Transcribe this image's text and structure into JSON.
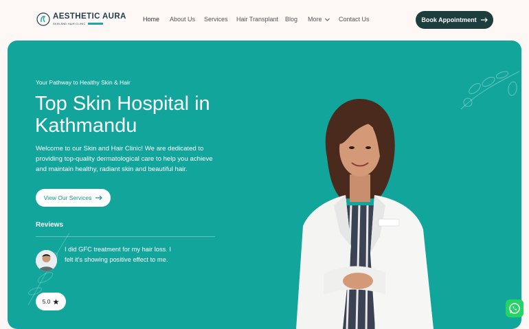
{
  "logo": {
    "name": "AESTHETIC AURA",
    "subtitle": "SKIN AND HAIR CLINIC"
  },
  "nav": {
    "items": [
      "Home",
      "About Us",
      "Services",
      "Hair Transplant",
      "Blog",
      "More",
      "Contact Us"
    ]
  },
  "header": {
    "cta_label": "Book Appointment"
  },
  "hero": {
    "tagline": "Your Pathway to Healthy Skin & Hair",
    "title": "Top Skin Hospital in Kathmandu",
    "description": "Welcome to our Skin and Hair Clinic! We are dedicated to providing top-quality dermatological care to help you achieve and maintain healthy, radiant skin and beautiful hair.",
    "cta_label": "View Our Services"
  },
  "reviews": {
    "label": "Reviews",
    "text": "I did GFC treatment for my hair loss. I felt it's showing positive effect to me.",
    "rating": "5.0"
  },
  "colors": {
    "teal": "#11a59b",
    "dark_button": "#1d3e3c",
    "whatsapp": "#25d366"
  },
  "icons": [
    "logo-mark-icon",
    "arrow-right-icon",
    "chevron-down-icon",
    "star-icon",
    "whatsapp-icon"
  ]
}
